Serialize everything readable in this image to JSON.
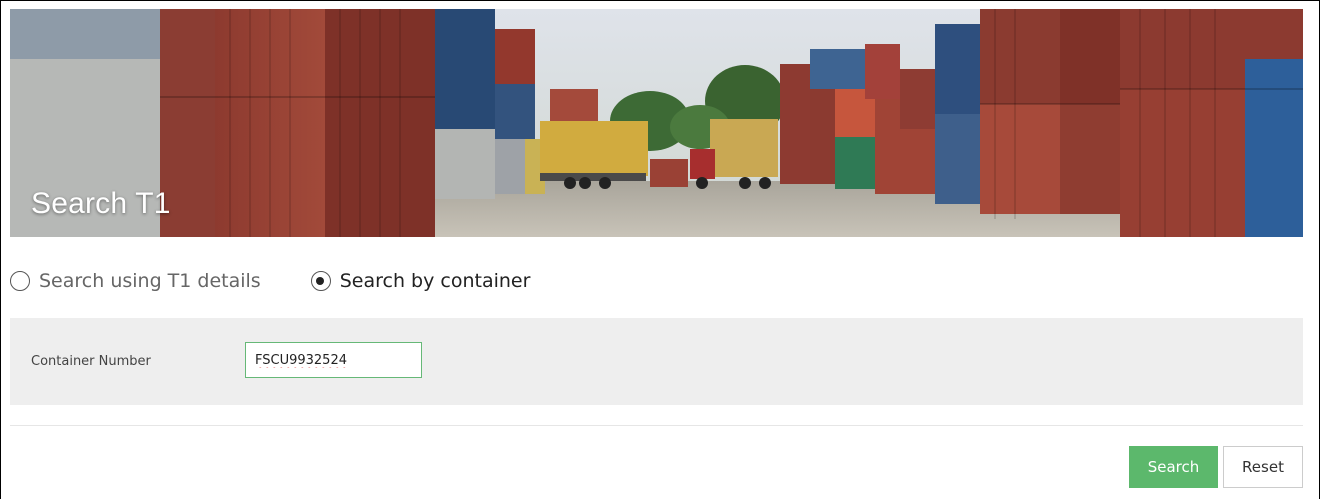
{
  "banner": {
    "title": "Search T1",
    "image": "container-yard-photo"
  },
  "search_mode": {
    "options": [
      {
        "label": "Search using T1 details",
        "checked": false
      },
      {
        "label": "Search by container",
        "checked": true
      }
    ]
  },
  "form": {
    "container_number_label": "Container Number",
    "container_number_value": "FSCU9932524"
  },
  "actions": {
    "search_label": "Search",
    "reset_label": "Reset"
  },
  "colors": {
    "primary_button": "#5cb86c",
    "input_focus_border": "#66b877",
    "panel_background": "#eeeeee"
  }
}
